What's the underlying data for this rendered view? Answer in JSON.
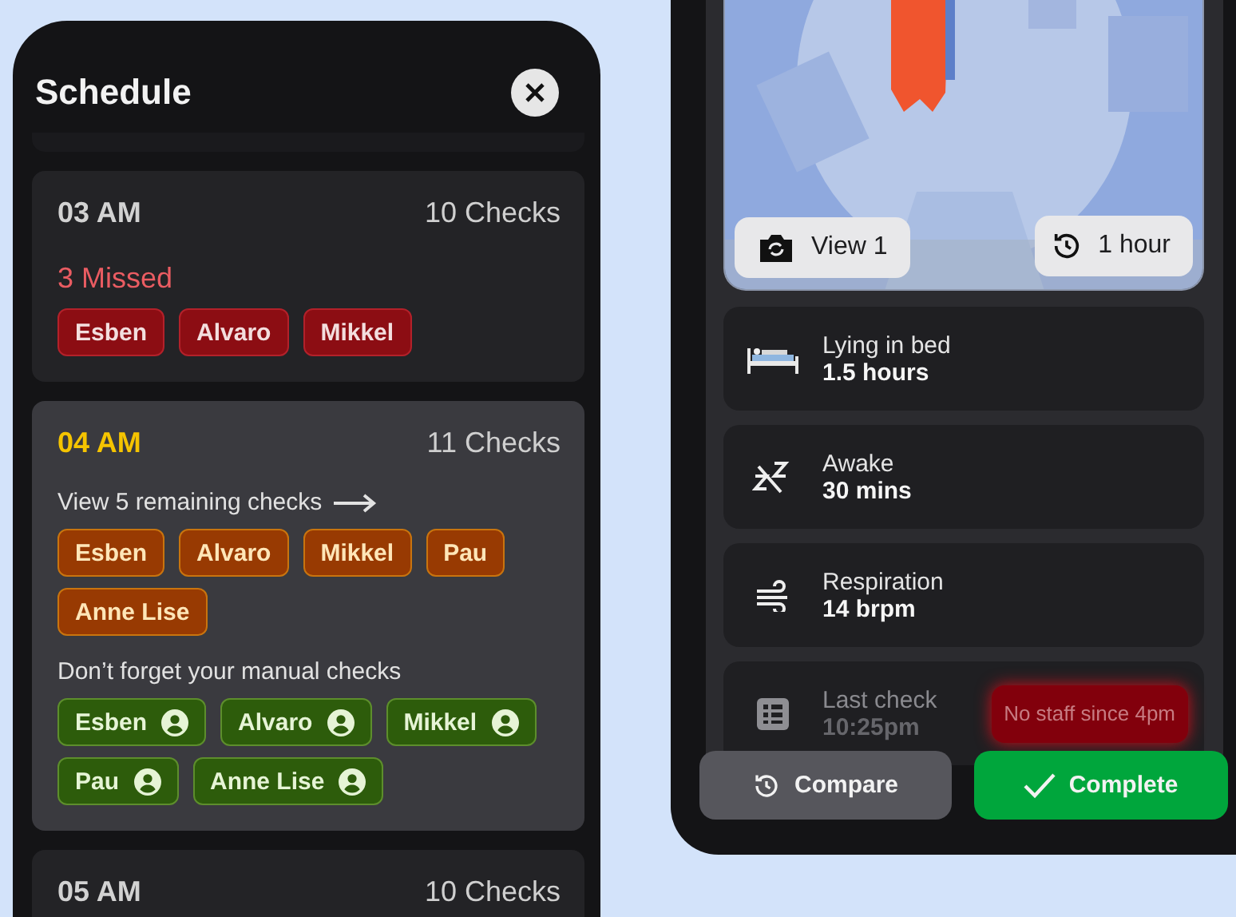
{
  "schedule": {
    "title": "Schedule",
    "slots": [
      {
        "time": "03 AM",
        "checks": "10 Checks",
        "selected": false,
        "sections": [
          {
            "kind": "missed",
            "label": "3 Missed",
            "chips": [
              "Esben",
              "Alvaro",
              "Mikkel"
            ]
          }
        ]
      },
      {
        "time": "04 AM",
        "checks": "11 Checks",
        "selected": true,
        "sections": [
          {
            "kind": "remaining",
            "label": "View 5 remaining checks",
            "chips": [
              "Esben",
              "Alvaro",
              "Mikkel",
              "Pau",
              "Anne Lise"
            ]
          },
          {
            "kind": "manual",
            "label": "Don’t forget your manual checks",
            "chips": [
              "Esben",
              "Alvaro",
              "Mikkel",
              "Pau",
              "Anne Lise"
            ]
          }
        ]
      },
      {
        "time": "05 AM",
        "checks": "10 Checks",
        "selected": false
      }
    ]
  },
  "monitor": {
    "camera": {
      "kind": "picture",
      "view_button": "View 1",
      "range_button": "1 hour"
    },
    "metrics": [
      {
        "kind": "bed",
        "label": "Lying in bed",
        "value": "1.5 hours",
        "faded": false
      },
      {
        "kind": "awake",
        "label": "Awake",
        "value": "30 mins",
        "faded": false
      },
      {
        "kind": "respiration",
        "label": "Respiration",
        "value": "14 brpm",
        "faded": false
      },
      {
        "kind": "check",
        "label": "Last check",
        "value": "10:25pm",
        "faded": true,
        "alert": "No staff since 4pm"
      }
    ],
    "buttons": [
      {
        "kind": "compare",
        "label": "Compare"
      },
      {
        "kind": "complete",
        "label": "Complete"
      }
    ]
  }
}
